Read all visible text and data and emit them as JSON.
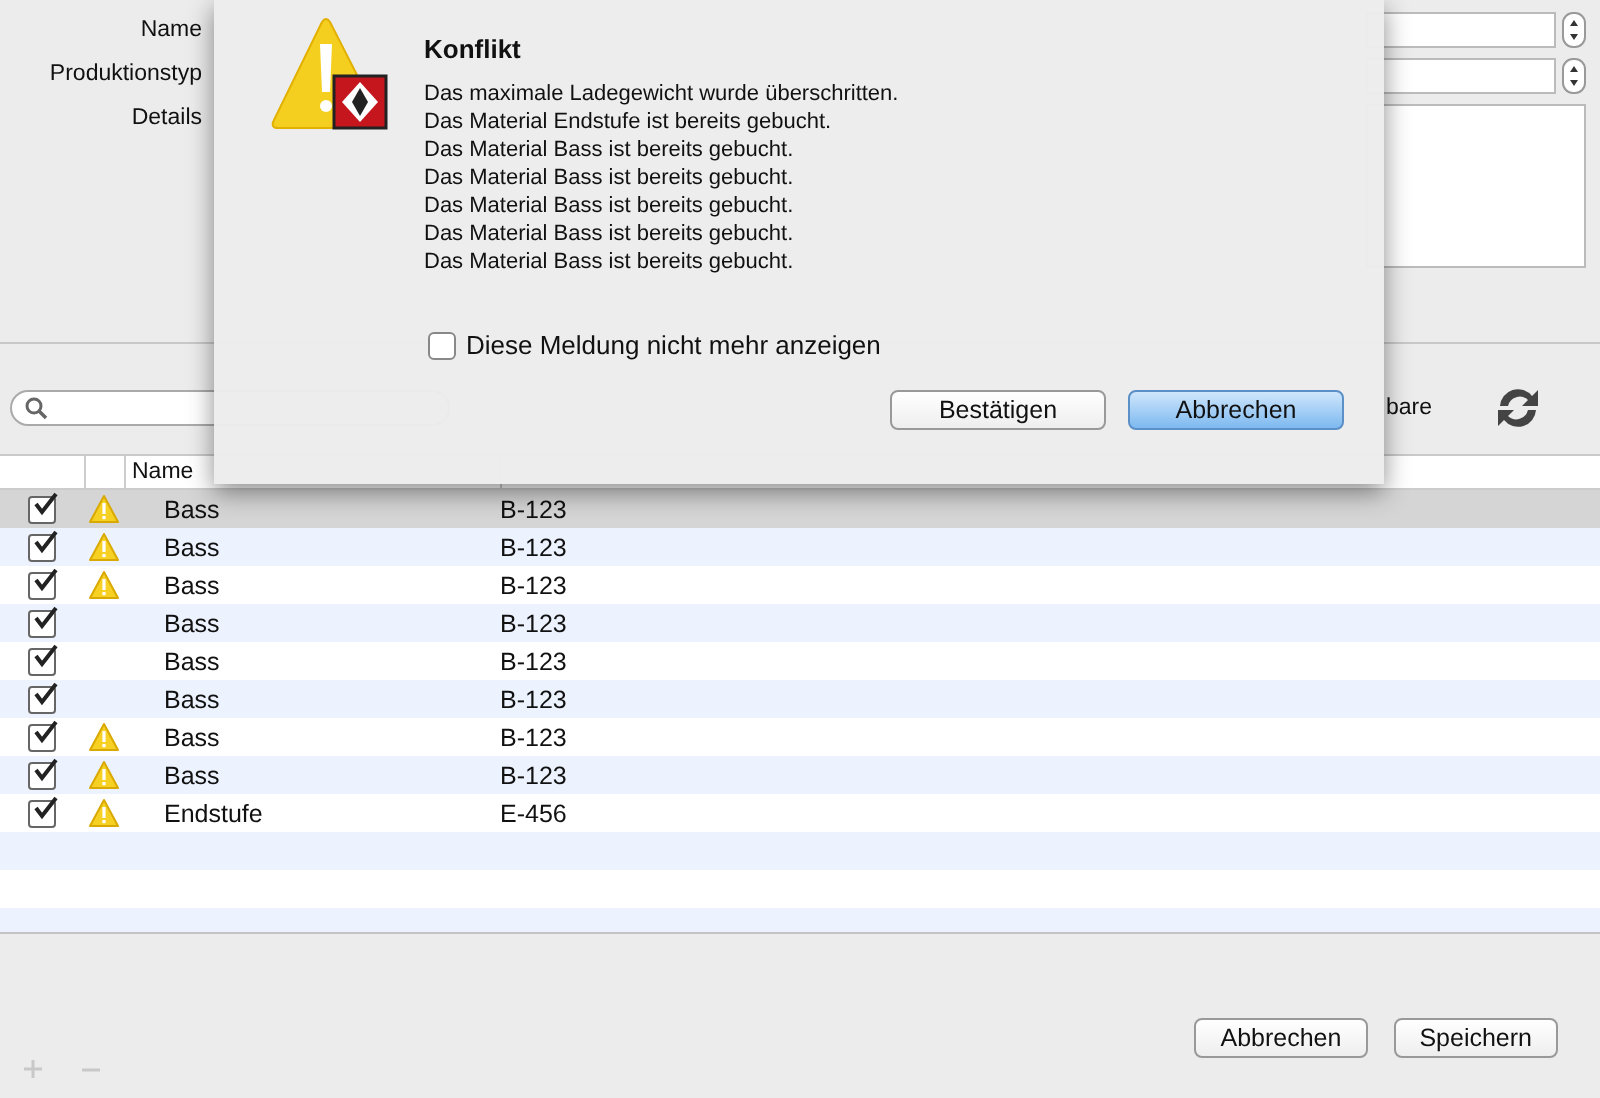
{
  "form": {
    "labels": [
      "Name",
      "Produktionstyp",
      "Details"
    ]
  },
  "toolbar": {
    "partial_label": "bare"
  },
  "table": {
    "columns": [
      "",
      "",
      "Name",
      ""
    ],
    "rows": [
      {
        "checked": true,
        "warning": true,
        "name": "Bass",
        "number": "B-123",
        "selected": true
      },
      {
        "checked": true,
        "warning": true,
        "name": "Bass",
        "number": "B-123",
        "selected": false
      },
      {
        "checked": true,
        "warning": true,
        "name": "Bass",
        "number": "B-123",
        "selected": false
      },
      {
        "checked": true,
        "warning": false,
        "name": "Bass",
        "number": "B-123",
        "selected": false
      },
      {
        "checked": true,
        "warning": false,
        "name": "Bass",
        "number": "B-123",
        "selected": false
      },
      {
        "checked": true,
        "warning": false,
        "name": "Bass",
        "number": "B-123",
        "selected": false
      },
      {
        "checked": true,
        "warning": true,
        "name": "Bass",
        "number": "B-123",
        "selected": false
      },
      {
        "checked": true,
        "warning": true,
        "name": "Bass",
        "number": "B-123",
        "selected": false
      },
      {
        "checked": true,
        "warning": true,
        "name": "Endstufe",
        "number": "E-456",
        "selected": false
      }
    ]
  },
  "buttons": [
    {
      "label": "Abbrechen",
      "default": false
    },
    {
      "label": "Speichern",
      "default": false
    }
  ],
  "dialog": {
    "title": "Konflikt",
    "messages": [
      "Das maximale Ladegewicht wurde überschritten.",
      "Das Material Endstufe ist bereits gebucht.",
      "Das Material Bass ist bereits gebucht.",
      "Das Material Bass ist bereits gebucht.",
      "Das Material Bass ist bereits gebucht.",
      "Das Material Bass ist bereits gebucht.",
      "Das Material Bass ist bereits gebucht."
    ],
    "suppress": {
      "label": "Diese Meldung nicht mehr anzeigen",
      "checked": false
    },
    "buttons": [
      {
        "label": "Bestätigen",
        "default": false
      },
      {
        "label": "Abbrechen",
        "default": true
      }
    ]
  }
}
